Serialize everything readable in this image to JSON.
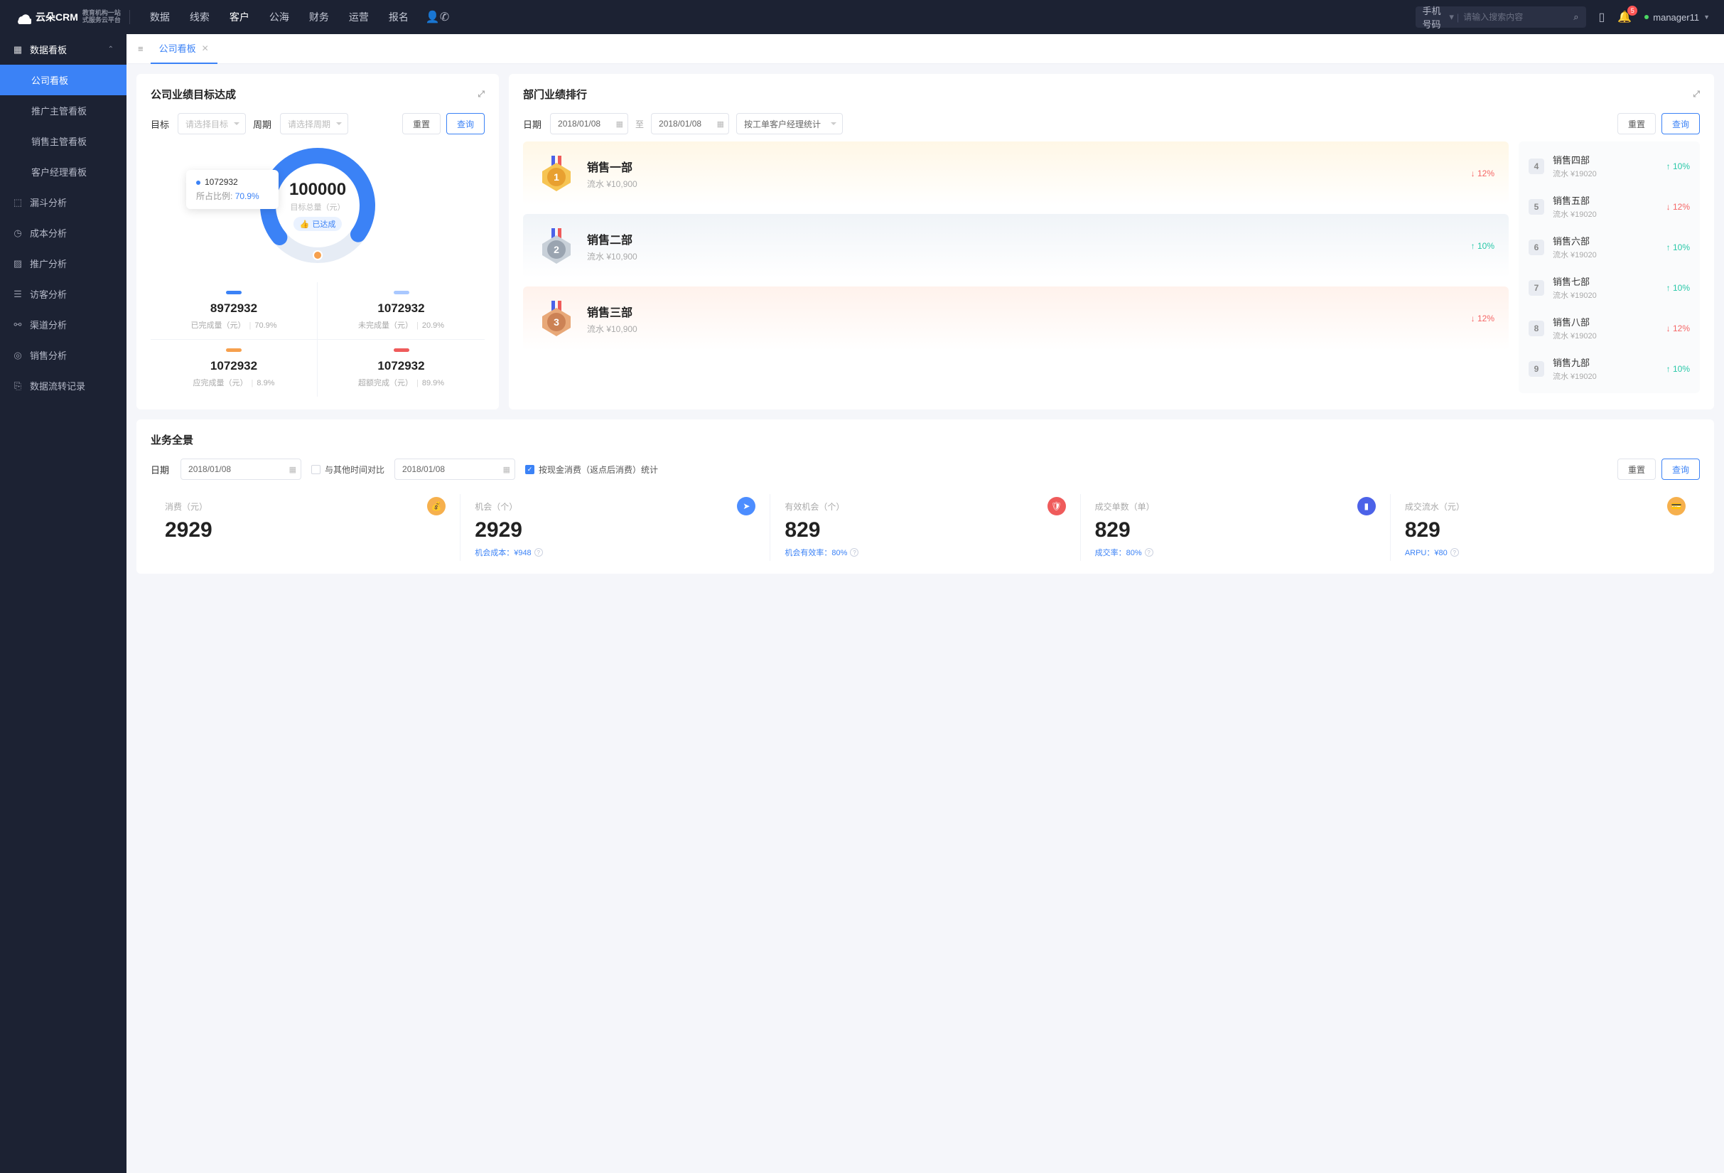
{
  "header": {
    "logo": {
      "brand": "云朵CRM",
      "sub1": "教育机构一站",
      "sub2": "式服务云平台"
    },
    "nav": [
      "数据",
      "线索",
      "客户",
      "公海",
      "财务",
      "运营",
      "报名"
    ],
    "search_type": "手机号码",
    "search_placeholder": "请输入搜索内容",
    "badge": "5",
    "user": "manager11"
  },
  "sidebar": {
    "group": "数据看板",
    "items": [
      "公司看板",
      "推广主管看板",
      "销售主管看板",
      "客户经理看板"
    ],
    "others": [
      "漏斗分析",
      "成本分析",
      "推广分析",
      "访客分析",
      "渠道分析",
      "销售分析",
      "数据流转记录"
    ]
  },
  "tabs": {
    "active": "公司看板"
  },
  "target_panel": {
    "title": "公司业绩目标达成",
    "lbl_target": "目标",
    "ph_target": "请选择目标",
    "lbl_period": "周期",
    "ph_period": "请选择周期",
    "reset": "重置",
    "query": "查询",
    "tooltip": {
      "value": "1072932",
      "ratio_label": "所占比例:",
      "ratio": "70.9%"
    },
    "center": {
      "value": "100000",
      "label": "目标总量（元）",
      "reached": "已达成"
    },
    "stats": [
      {
        "value": "8972932",
        "label": "已完成量（元）",
        "pct": "70.9%"
      },
      {
        "value": "1072932",
        "label": "未完成量（元）",
        "pct": "20.9%"
      },
      {
        "value": "1072932",
        "label": "应完成量（元）",
        "pct": "8.9%"
      },
      {
        "value": "1072932",
        "label": "超额完成（元）",
        "pct": "89.9%"
      }
    ]
  },
  "rank_panel": {
    "title": "部门业绩排行",
    "lbl_date": "日期",
    "date1": "2018/01/08",
    "to": "至",
    "date2": "2018/01/08",
    "stat_by": "按工单客户经理统计",
    "reset": "重置",
    "query": "查询",
    "top3": [
      {
        "name": "销售一部",
        "sub": "流水 ¥10,900",
        "trend": "12%",
        "dir": "down"
      },
      {
        "name": "销售二部",
        "sub": "流水 ¥10,900",
        "trend": "10%",
        "dir": "up"
      },
      {
        "name": "销售三部",
        "sub": "流水 ¥10,900",
        "trend": "12%",
        "dir": "down"
      }
    ],
    "rest": [
      {
        "num": "4",
        "name": "销售四部",
        "sub": "流水 ¥19020",
        "trend": "10%",
        "dir": "up"
      },
      {
        "num": "5",
        "name": "销售五部",
        "sub": "流水 ¥19020",
        "trend": "12%",
        "dir": "down"
      },
      {
        "num": "6",
        "name": "销售六部",
        "sub": "流水 ¥19020",
        "trend": "10%",
        "dir": "up"
      },
      {
        "num": "7",
        "name": "销售七部",
        "sub": "流水 ¥19020",
        "trend": "10%",
        "dir": "up"
      },
      {
        "num": "8",
        "name": "销售八部",
        "sub": "流水 ¥19020",
        "trend": "12%",
        "dir": "down"
      },
      {
        "num": "9",
        "name": "销售九部",
        "sub": "流水 ¥19020",
        "trend": "10%",
        "dir": "up"
      }
    ]
  },
  "overview": {
    "title": "业务全景",
    "lbl_date": "日期",
    "date1": "2018/01/08",
    "compare": "与其他时间对比",
    "date2": "2018/01/08",
    "cash_stat": "按现金消费（返点后消费）统计",
    "reset": "重置",
    "query": "查询",
    "kpis": [
      {
        "label": "消费（元）",
        "value": "2929",
        "sub": ""
      },
      {
        "label": "机会（个）",
        "value": "2929",
        "sub": "机会成本：¥948"
      },
      {
        "label": "有效机会（个）",
        "value": "829",
        "sub": "机会有效率：80%"
      },
      {
        "label": "成交单数（单）",
        "value": "829",
        "sub": "成交率：80%"
      },
      {
        "label": "成交流水（元）",
        "value": "829",
        "sub": "ARPU：¥80"
      }
    ]
  },
  "chart_data": {
    "type": "pie",
    "title": "目标总量（元） 100000",
    "series": [
      {
        "name": "已完成量",
        "value": 70.9,
        "color": "#3b82f6"
      },
      {
        "name": "未完成量",
        "value": 29.1,
        "color": "#e6ecf5"
      }
    ]
  }
}
